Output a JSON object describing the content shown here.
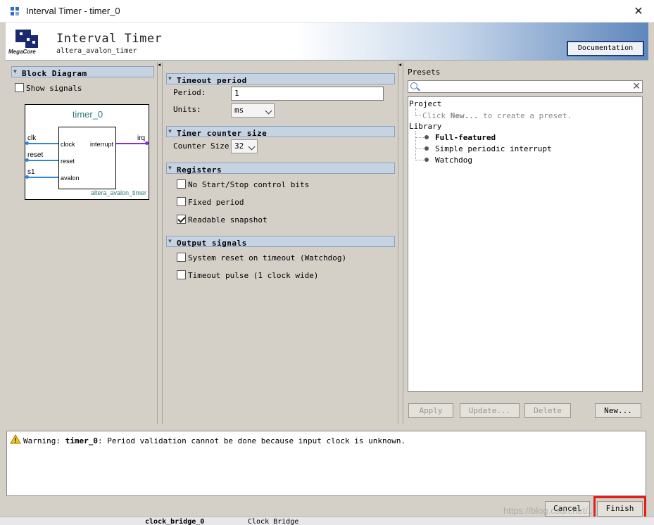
{
  "window": {
    "title": "Interval Timer - timer_0",
    "close_glyph": "✕"
  },
  "header": {
    "title": "Interval Timer",
    "subtitle": "altera_avalon_timer",
    "logo_text": "MegaCore",
    "documentation_button": "Documentation"
  },
  "left": {
    "section_title": "Block Diagram",
    "show_signals_label": "Show signals",
    "show_signals_checked": false,
    "diagram": {
      "component_name": "timer_0",
      "signals": [
        "clk",
        "reset",
        "s1"
      ],
      "ports": [
        "clock",
        "reset",
        "avalon"
      ],
      "out_port": "interrupt",
      "out_signal": "irq",
      "class_name": "altera_avalon_timer"
    }
  },
  "middle": {
    "timeout_section": "Timeout period",
    "period_label": "Period:",
    "period_value": "1",
    "units_label": "Units:",
    "units_value": "ms",
    "counter_section": "Timer counter size",
    "counter_size_label": "Counter Size:",
    "counter_size_value": "32",
    "registers_section": "Registers",
    "registers": [
      {
        "label": "No Start/Stop control bits",
        "checked": false
      },
      {
        "label": "Fixed period",
        "checked": false
      },
      {
        "label": "Readable snapshot",
        "checked": true
      }
    ],
    "output_section": "Output signals",
    "outputs": [
      {
        "label": "System reset on timeout (Watchdog)",
        "checked": false
      },
      {
        "label": "Timeout pulse (1 clock wide)",
        "checked": false
      }
    ]
  },
  "presets": {
    "title": "Presets",
    "search_placeholder": "",
    "project_label": "Project",
    "project_hint_prefix": "Click ",
    "project_hint_bold": "New...",
    "project_hint_suffix": " to create a preset.",
    "library_label": "Library",
    "library_items": [
      "Full-featured",
      "Simple periodic interrupt",
      "Watchdog"
    ],
    "buttons": {
      "apply": "Apply",
      "update": "Update...",
      "delete": "Delete",
      "new": "New..."
    }
  },
  "messages": {
    "prefix": "Warning: ",
    "component": "timer_0",
    "text": ": Period validation cannot be done because input clock is unknown."
  },
  "footer": {
    "cancel": "Cancel",
    "finish": "Finish"
  },
  "background": {
    "row_name": "clock_bridge_0",
    "row_type": "Clock Bridge"
  },
  "watermark": "https://blog.csdn.net/..."
}
